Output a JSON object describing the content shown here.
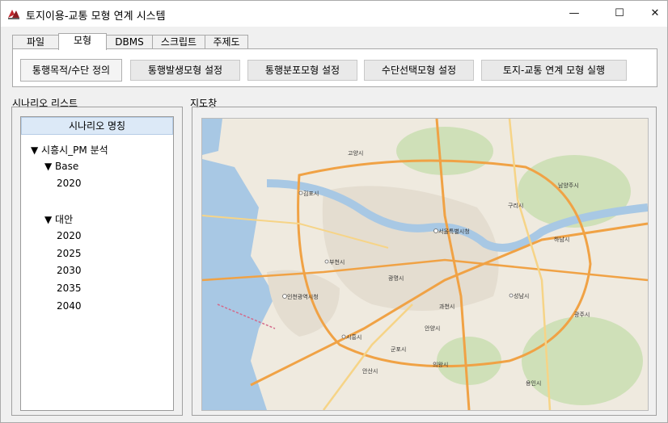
{
  "window": {
    "title": "토지이용-교통 모형 연계 시스템",
    "minimize": "—",
    "maximize": "☐",
    "close": "✕"
  },
  "tabs": [
    "파일",
    "모형",
    "DBMS",
    "스크립트",
    "주제도"
  ],
  "active_tab": "모형",
  "toolbar": {
    "buttons": [
      "통행목적/수단 정의",
      "통행발생모형 설정",
      "통행분포모형 설정",
      "수단선택모형 설정",
      "토지-교통 연계 모형 실행"
    ]
  },
  "scenario_panel": {
    "title": "시나리오 리스트",
    "header": "시나리오 명칭",
    "root": "▼ 시흥시_PM 분석",
    "base_group": "▼ Base",
    "base_years": [
      "2020"
    ],
    "alt_group": "▼ 대안",
    "alt_years": [
      "2020",
      "2025",
      "2030",
      "2035",
      "2040"
    ]
  },
  "map_panel": {
    "title": "지도창",
    "labels": {
      "seoul": "서울특별시청",
      "incheon": "인천광역시청",
      "gimpo": "김포시",
      "bucheon": "부천시",
      "guri": "구리시",
      "hanam": "하남시",
      "gwangmyeong": "광명시",
      "anyang": "안양시",
      "gwacheon": "과천시",
      "siheung": "시흥시",
      "seongnam": "성남시",
      "ansan": "안산시",
      "uiwang": "의왕시",
      "gunpo": "군포시",
      "gwangju": "광주시",
      "namyangju": "남양주시",
      "goyang": "고양시",
      "yongin": "용인시"
    }
  },
  "colors": {
    "water": "#a8c8e4",
    "land": "#efeadf",
    "park": "#cfe0b8",
    "highway": "#f0a245",
    "road": "#f6d487",
    "urban": "#e4ddd0"
  }
}
